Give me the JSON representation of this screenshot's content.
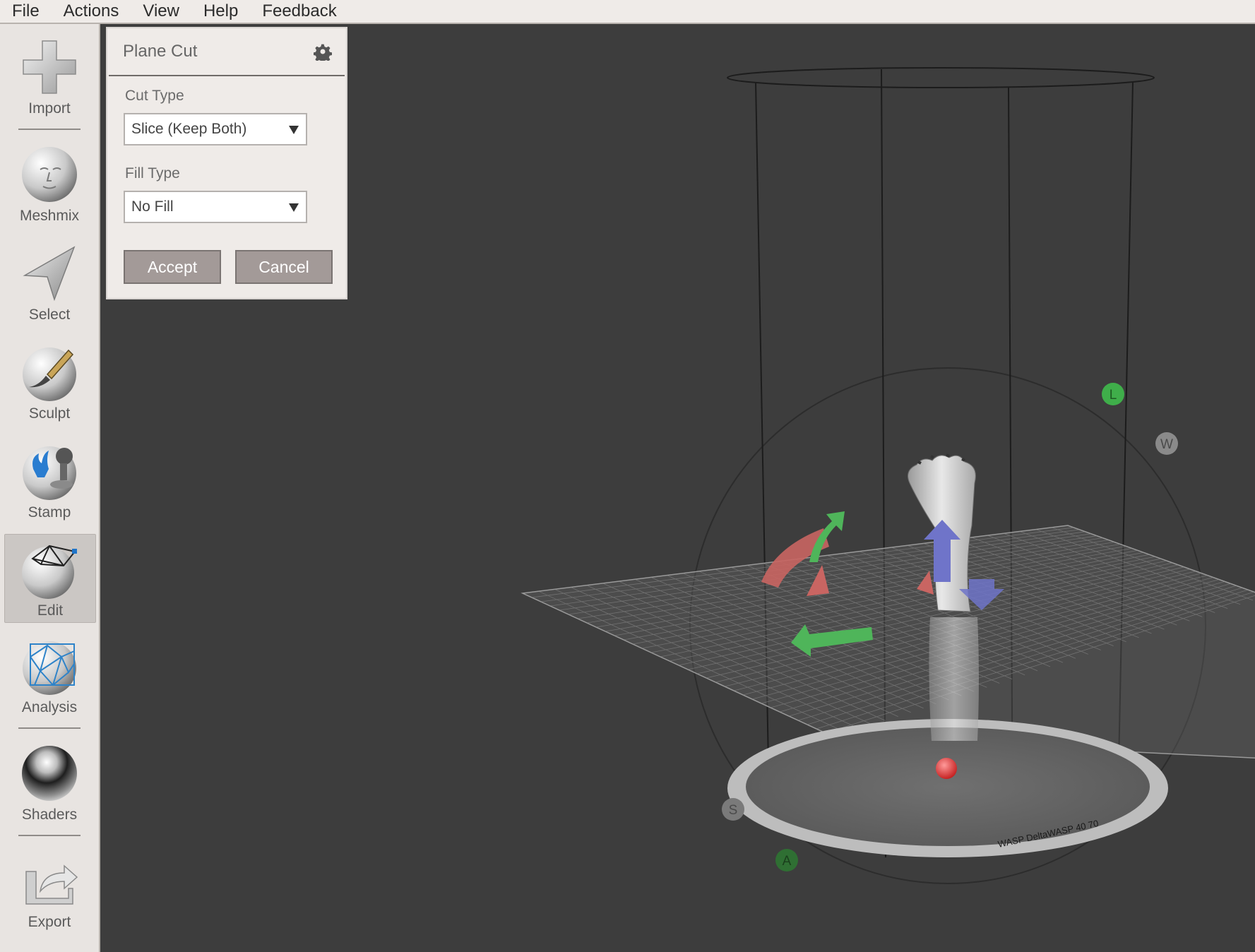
{
  "menu": [
    "File",
    "Actions",
    "View",
    "Help",
    "Feedback"
  ],
  "toolbar": {
    "items": [
      {
        "label": "Import",
        "icon": "plus-icon"
      },
      {
        "label": "Meshmix",
        "icon": "face-sphere-icon"
      },
      {
        "label": "Select",
        "icon": "arrow-cursor-icon"
      },
      {
        "label": "Sculpt",
        "icon": "brush-sphere-icon"
      },
      {
        "label": "Stamp",
        "icon": "stamp-icon"
      },
      {
        "label": "Edit",
        "icon": "wireframe-sphere-icon"
      },
      {
        "label": "Analysis",
        "icon": "mesh-sphere-icon"
      },
      {
        "label": "Shaders",
        "icon": "chrome-sphere-icon"
      },
      {
        "label": "Export",
        "icon": "export-icon"
      }
    ],
    "active": "Edit"
  },
  "panel": {
    "title": "Plane Cut",
    "settings_icon": "gear-icon",
    "cut_type_label": "Cut Type",
    "cut_type_value": "Slice (Keep Both)",
    "fill_type_label": "Fill Type",
    "fill_type_value": "No Fill",
    "accept_label": "Accept",
    "cancel_label": "Cancel"
  },
  "viewport": {
    "printer_label": "WASP DeltaWASP 40 70",
    "markers": [
      "L",
      "W",
      "S",
      "A"
    ]
  },
  "colors": {
    "viewport_bg": "#3d3d3d",
    "button_bg": "#a39a98",
    "gizmo_red": "#d46b66",
    "gizmo_green": "#4fb55a",
    "gizmo_blue": "#6f74c9"
  }
}
